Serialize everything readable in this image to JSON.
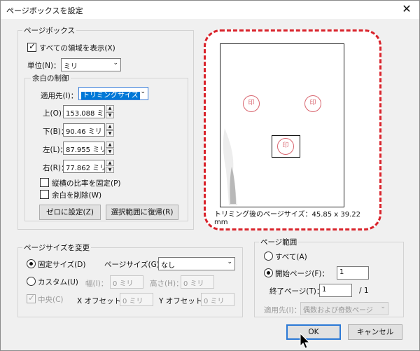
{
  "window": {
    "title": "ページボックスを設定"
  },
  "page_box": {
    "legend": "ページボックス",
    "show_all": "すべての領域を表示(X)",
    "unit_label": "単位(N)：",
    "unit_value": "ミリ",
    "margin_group": "余白の制御",
    "apply_to_label": "適用先(I)：",
    "apply_to_value": "トリミングサイズ",
    "top_label": "上(O)：",
    "top_value": "153.088 ミリ",
    "bottom_label": "下(B)：",
    "bottom_value": "90.46 ミリ",
    "left_label": "左(L)：",
    "left_value": "87.955 ミリ",
    "right_label": "右(R)：",
    "right_value": "77.862 ミリ",
    "lock_ratio": "縦横の比率を固定(P)",
    "remove_white": "余白を削除(W)",
    "set_zero_button": "ゼロに設定(Z)",
    "revert_button": "選択範囲に復帰(R)"
  },
  "preview": {
    "seal_glyph": "印",
    "caption": "トリミング後のページサイズ：45.85 x 39.22 mm",
    "highlight_color": "#d9232b"
  },
  "page_size": {
    "legend": "ページサイズを変更",
    "fixed_label": "固定サイズ(D)",
    "page_size_label": "ページサイズ(G)：",
    "page_size_value": "なし",
    "custom_label": "カスタム(U)",
    "width_label": "幅(I)：",
    "width_value": "0 ミリ",
    "height_label": "高さ(H)：",
    "height_value": "0 ミリ",
    "center_label": "中央(C)",
    "x_offset_label": "X オフセット：",
    "x_offset_value": "0 ミリ",
    "y_offset_label": "Y オフセット：",
    "y_offset_value": "0 ミリ"
  },
  "page_range": {
    "legend": "ページ範囲",
    "all_label": "すべて(A)",
    "start_label": "開始ページ(F)：",
    "start_value": "1",
    "end_label": "終了ページ(T)：",
    "end_value": "1",
    "of_total": "/ 1",
    "apply_label": "適用先(I)：",
    "apply_value": "偶数および奇数ページ"
  },
  "buttons": {
    "ok": "OK",
    "cancel": "キャンセル"
  }
}
